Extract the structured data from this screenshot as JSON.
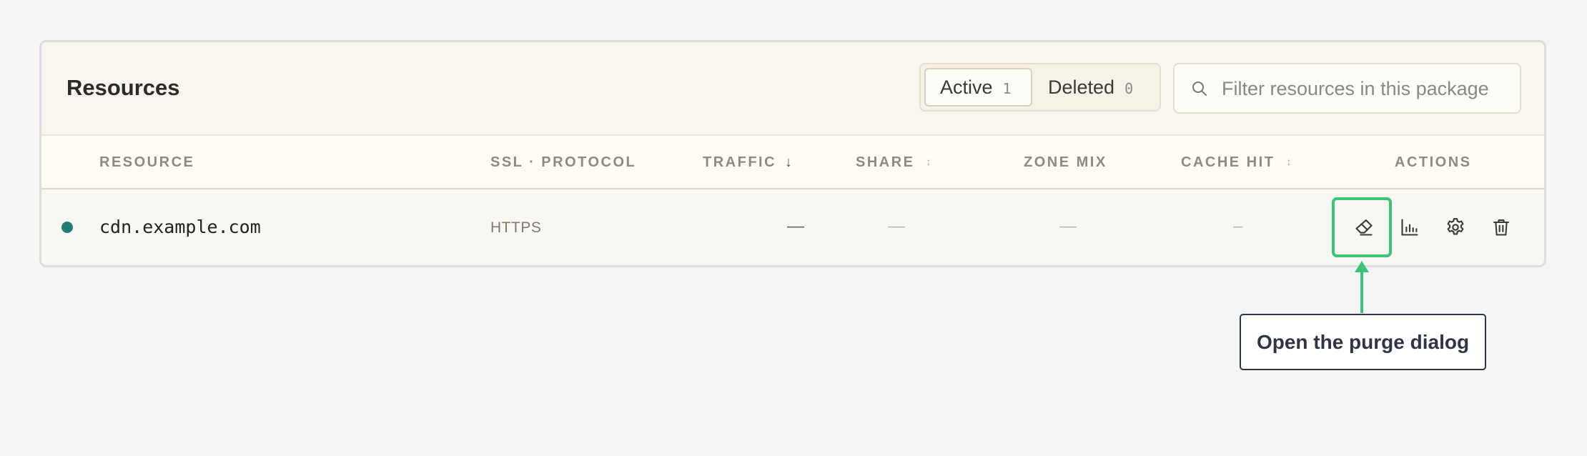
{
  "header": {
    "title": "Resources"
  },
  "tabs": [
    {
      "label": "Active",
      "count": "1"
    },
    {
      "label": "Deleted",
      "count": "0"
    }
  ],
  "search": {
    "placeholder": "Filter resources in this package",
    "value": ""
  },
  "columns": {
    "resource": "RESOURCE",
    "ssl_protocol": "SSL · PROTOCOL",
    "traffic": "TRAFFIC",
    "traffic_sort": "↓",
    "share": "SHARE",
    "share_sort": "↕",
    "zone_mix": "ZONE MIX",
    "cache_hit": "CACHE HIT",
    "cache_hit_sort": "↕",
    "actions": "ACTIONS"
  },
  "rows": [
    {
      "status_color": "#1f7d74",
      "resource": "cdn.example.com",
      "protocol": "HTTPS",
      "traffic": "—",
      "share": "—",
      "zone_mix": "—",
      "cache_hit": "–"
    }
  ],
  "actions": [
    {
      "name": "purge",
      "icon": "eraser-icon"
    },
    {
      "name": "stats",
      "icon": "bar-chart-icon"
    },
    {
      "name": "settings",
      "icon": "gear-icon"
    },
    {
      "name": "delete",
      "icon": "trash-icon"
    }
  ],
  "annotation": {
    "callout": "Open the purge dialog",
    "accent": "#3ec27a"
  }
}
